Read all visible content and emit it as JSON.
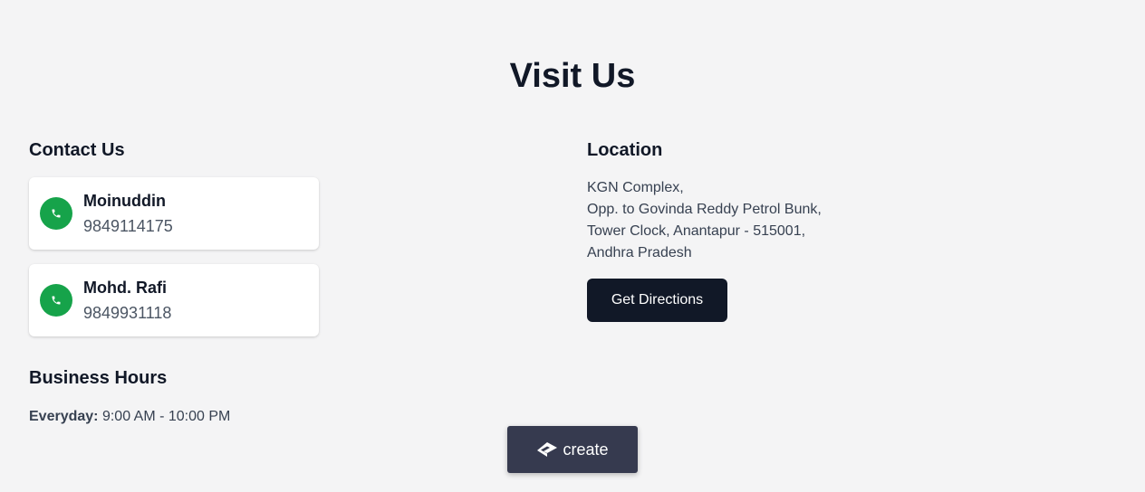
{
  "page": {
    "title": "Visit Us"
  },
  "contact": {
    "heading": "Contact Us",
    "people": [
      {
        "name": "Moinuddin",
        "phone": "9849114175"
      },
      {
        "name": "Mohd. Rafi",
        "phone": "9849931118"
      }
    ]
  },
  "business_hours": {
    "heading": "Business Hours",
    "label": "Everyday:",
    "value": " 9:00 AM - 10:00 PM"
  },
  "location": {
    "heading": "Location",
    "address_lines": [
      "KGN Complex,",
      "Opp. to Govinda Reddy Petrol Bunk,",
      "Tower Clock, Anantapur - 515001,",
      "Andhra Pradesh"
    ],
    "directions_label": "Get Directions"
  },
  "badge": {
    "label": "create",
    "icon": "create-logo-icon"
  },
  "colors": {
    "background": "#f4f4f5",
    "phone_icon_bg": "#16a34a",
    "button_bg": "#111827",
    "badge_bg": "#363a4f"
  }
}
